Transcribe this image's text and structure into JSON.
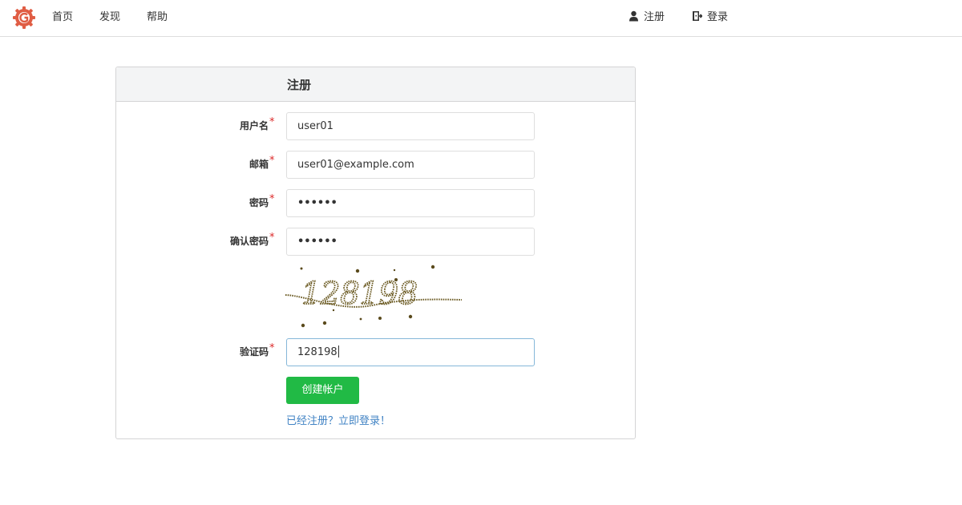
{
  "navbar": {
    "logo_icon": "gitea-logo-icon",
    "logo_color": "#e05d44",
    "items": [
      {
        "label": "首页"
      },
      {
        "label": "发现"
      },
      {
        "label": "帮助"
      }
    ],
    "right_items": [
      {
        "label": "注册",
        "icon": "user-icon"
      },
      {
        "label": "登录",
        "icon": "sign-in-icon"
      }
    ]
  },
  "register": {
    "title": "注册",
    "required_marker": "*",
    "username": {
      "label": "用户名",
      "value": "user01"
    },
    "email": {
      "label": "邮箱",
      "value": "user01@example.com"
    },
    "password": {
      "label": "密码",
      "value": "••••••"
    },
    "confirm_password": {
      "label": "确认密码",
      "value": "••••••"
    },
    "captcha_image": {
      "text": "128198"
    },
    "captcha": {
      "label": "验证码",
      "value": "128198"
    },
    "submit_label": "创建帐户",
    "login_link": "已经注册？立即登录！"
  },
  "colors": {
    "primary_green": "#21ba45",
    "link_blue": "#4183c4",
    "required_red": "#db2828",
    "focus_border": "#85b7d9"
  }
}
